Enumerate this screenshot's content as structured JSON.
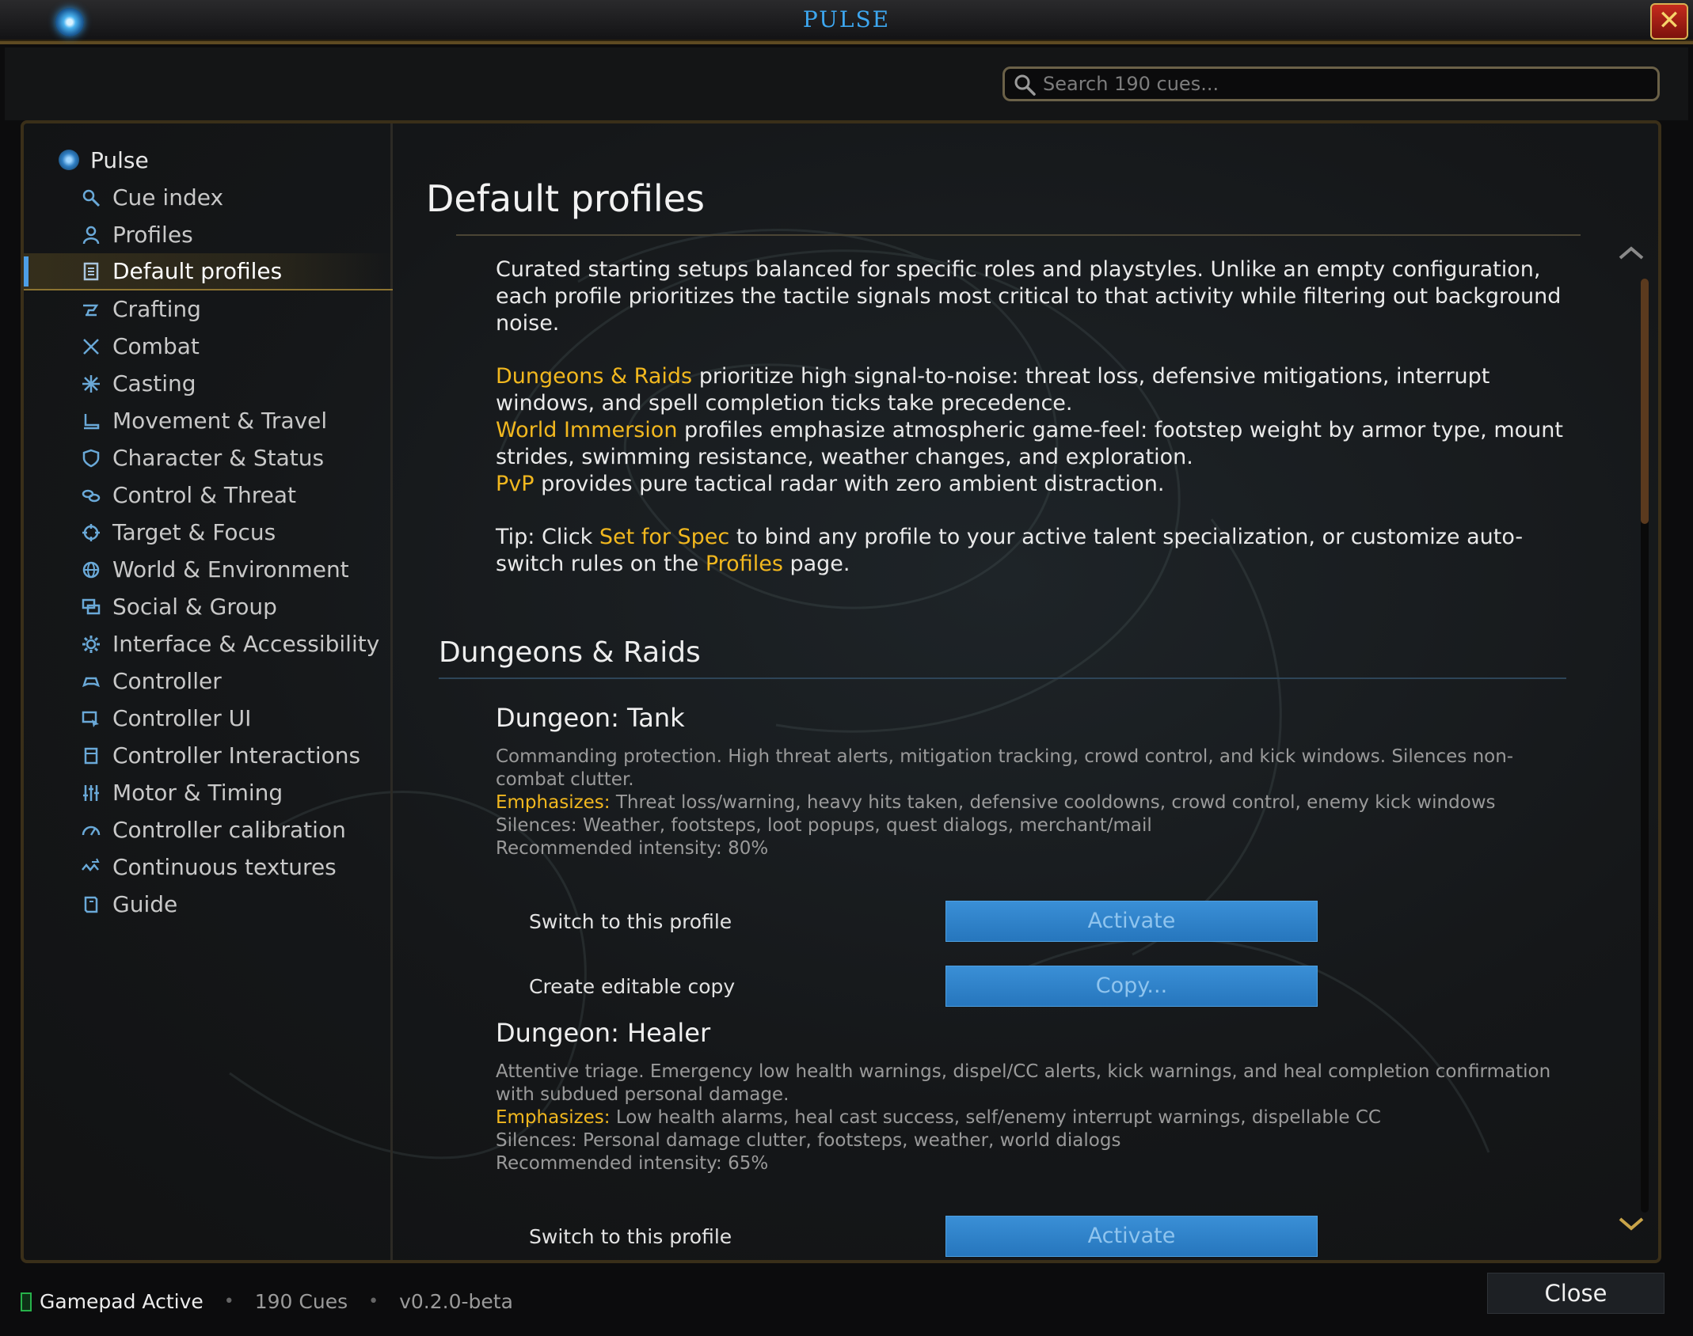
{
  "window": {
    "title": "PULSE",
    "close_icon": "close-icon",
    "accent": "#3da7f0"
  },
  "search": {
    "placeholder": "Search 190 cues..."
  },
  "sidebar": {
    "root": "Pulse",
    "items": [
      {
        "label": "Cue index",
        "icon": "search-icon"
      },
      {
        "label": "Profiles",
        "icon": "person-icon"
      },
      {
        "label": "Default profiles",
        "icon": "document-icon",
        "active": true
      },
      {
        "label": "Crafting",
        "icon": "anvil-icon"
      },
      {
        "label": "Combat",
        "icon": "crossed-swords-icon"
      },
      {
        "label": "Casting",
        "icon": "spark-icon"
      },
      {
        "label": "Movement & Travel",
        "icon": "boot-icon"
      },
      {
        "label": "Character & Status",
        "icon": "shield-icon"
      },
      {
        "label": "Control & Threat",
        "icon": "chain-icon"
      },
      {
        "label": "Target & Focus",
        "icon": "crosshair-icon"
      },
      {
        "label": "World & Environment",
        "icon": "globe-icon"
      },
      {
        "label": "Social & Group",
        "icon": "chat-icon"
      },
      {
        "label": "Interface & Accessibility",
        "icon": "gear-icon"
      },
      {
        "label": "Controller",
        "icon": "gamepad-icon"
      },
      {
        "label": "Controller UI",
        "icon": "monitor-icon"
      },
      {
        "label": "Controller Interactions",
        "icon": "hand-icon"
      },
      {
        "label": "Motor & Timing",
        "icon": "sliders-icon"
      },
      {
        "label": "Controller calibration",
        "icon": "gauge-icon"
      },
      {
        "label": "Continuous textures",
        "icon": "wave-icon"
      },
      {
        "label": "Guide",
        "icon": "book-icon"
      }
    ]
  },
  "main": {
    "title": "Default profiles",
    "intro_1": "Curated starting setups balanced for specific roles and playstyles. Unlike an empty configuration, each profile prioritizes the tactile signals most critical to that activity while filtering out background noise.",
    "dr_term": "Dungeons & Raids",
    "dr_text": " prioritize high signal-to-noise: threat loss, defensive mitigations, interrupt windows, and spell completion ticks take precedence.",
    "wi_term": "World Immersion",
    "wi_text": " profiles emphasize atmospheric game-feel: footstep weight by armor type, mount strides, swimming resistance, weather changes, and exploration.",
    "pvp_term": "PvP",
    "pvp_text": " provides pure tactical radar with zero ambient distraction.",
    "tip_prefix": "Tip: Click ",
    "tip_link1": "Set for Spec",
    "tip_mid": " to bind any profile to your active talent specialization, or customize auto-switch rules on the ",
    "tip_link2": "Profiles",
    "tip_suffix": " page.",
    "section_title": "Dungeons & Raids",
    "profiles": [
      {
        "name": "Dungeon: Tank",
        "description": "Commanding protection. High threat alerts, mitigation tracking, crowd control, and kick windows. Silences non-combat clutter.",
        "emphasizes_label": "Emphasizes:",
        "emphasizes": " Threat loss/warning, heavy hits taken, defensive cooldowns, crowd control, enemy kick windows",
        "silences": "Silences: Weather, footsteps, loot popups, quest dialogs, merchant/mail",
        "intensity": "Recommended intensity: 80%",
        "switch_label": "Switch to this profile",
        "activate_label": "Activate",
        "copy_row_label": "Create editable copy",
        "copy_label": "Copy..."
      },
      {
        "name": "Dungeon: Healer",
        "description": "Attentive triage. Emergency low health warnings, dispel/CC alerts, kick warnings, and heal completion confirmation with subdued personal damage.",
        "emphasizes_label": "Emphasizes:",
        "emphasizes": " Low health alarms, heal cast success, self/enemy interrupt warnings, dispellable CC",
        "silences": "Silences: Personal damage clutter, footsteps, weather, world dialogs",
        "intensity": "Recommended intensity: 65%",
        "switch_label": "Switch to this profile",
        "activate_label": "Activate"
      }
    ]
  },
  "footer": {
    "status": "Gamepad Active",
    "cues": "190 Cues",
    "version": "v0.2.0-beta",
    "close_label": "Close",
    "status_color": "#27b24a"
  }
}
